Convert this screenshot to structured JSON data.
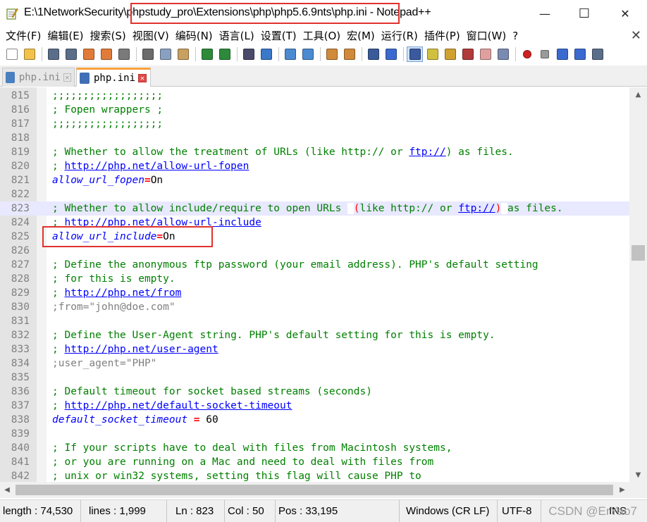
{
  "window": {
    "title": "E:\\1NetworkSecurity\\phpstudy_pro\\Extensions\\php\\php5.6.9nts\\php.ini - Notepad++",
    "controls": {
      "minimize": "—",
      "maximize": "☐",
      "close": "✕"
    }
  },
  "menu": {
    "items": [
      "文件(F)",
      "编辑(E)",
      "搜索(S)",
      "视图(V)",
      "编码(N)",
      "语言(L)",
      "设置(T)",
      "工具(O)",
      "宏(M)",
      "运行(R)",
      "插件(P)",
      "窗口(W)",
      "?"
    ],
    "close": "✕"
  },
  "toolbar": {
    "icons": [
      "new-file-icon",
      "open-file-icon",
      "save-icon",
      "save-all-icon",
      "close-file-icon",
      "close-all-icon",
      "print-icon",
      "cut-icon",
      "copy-icon",
      "paste-icon",
      "undo-icon",
      "redo-icon",
      "find-icon",
      "replace-icon",
      "zoom-in-icon",
      "zoom-out-icon",
      "sync-v-icon",
      "sync-h-icon",
      "word-wrap-icon",
      "show-all-chars-icon",
      "indent-guide-icon",
      "udl-icon",
      "doc-map-icon",
      "function-list-icon",
      "folder-workspace-icon",
      "monitor-icon",
      "record-macro-icon",
      "stop-record-icon",
      "play-macro-icon",
      "run-macro-multiple-icon",
      "save-macro-icon"
    ]
  },
  "tabs": [
    {
      "label": "php.ini",
      "active": false
    },
    {
      "label": "php.ini",
      "active": true
    }
  ],
  "editor": {
    "lines": [
      {
        "n": "815",
        "text": ";;;;;;;;;;;;;;;;;;"
      },
      {
        "n": "816",
        "text": "; Fopen wrappers ;"
      },
      {
        "n": "817",
        "text": ";;;;;;;;;;;;;;;;;;"
      },
      {
        "n": "818",
        "text": ""
      },
      {
        "n": "819",
        "text": "; Whether to allow the treatment of URLs (like http:// or ftp://) as files."
      },
      {
        "n": "820",
        "text": "; http://php.net/allow-url-fopen"
      },
      {
        "n": "821",
        "text": "allow_url_fopen=On"
      },
      {
        "n": "822",
        "text": ""
      },
      {
        "n": "823",
        "text": "; Whether to allow include/require to open URLs (like http:// or ftp://) as files."
      },
      {
        "n": "824",
        "text": "; http://php.net/allow-url-include"
      },
      {
        "n": "825",
        "text": "allow_url_include=On"
      },
      {
        "n": "826",
        "text": ""
      },
      {
        "n": "827",
        "text": "; Define the anonymous ftp password (your email address). PHP's default setting"
      },
      {
        "n": "828",
        "text": "; for this is empty."
      },
      {
        "n": "829",
        "text": "; http://php.net/from"
      },
      {
        "n": "830",
        "text": ";from=\"john@doe.com\""
      },
      {
        "n": "831",
        "text": ""
      },
      {
        "n": "832",
        "text": "; Define the User-Agent string. PHP's default setting for this is empty."
      },
      {
        "n": "833",
        "text": "; http://php.net/user-agent"
      },
      {
        "n": "834",
        "text": ";user_agent=\"PHP\""
      },
      {
        "n": "835",
        "text": ""
      },
      {
        "n": "836",
        "text": "; Default timeout for socket based streams (seconds)"
      },
      {
        "n": "837",
        "text": "; http://php.net/default-socket-timeout"
      },
      {
        "n": "838",
        "text": "default_socket_timeout = 60"
      },
      {
        "n": "839",
        "text": ""
      },
      {
        "n": "840",
        "text": "; If your scripts have to deal with files from Macintosh systems,"
      },
      {
        "n": "841",
        "text": "; or you are running on a Mac and need to deal with files from"
      },
      {
        "n": "842",
        "text": "; unix or win32 systems, setting this flag will cause PHP to"
      }
    ],
    "current_line": "823"
  },
  "status": {
    "length": "length : 74,530",
    "lines": "lines : 1,999",
    "ln": "Ln : 823",
    "col": "Col : 50",
    "pos": "Pos : 33,195",
    "eol": "Windows (CR LF)",
    "encoding": "UTF-8",
    "mode": "INS",
    "watermark": "CSDN @ErYao7"
  },
  "colors": {
    "comment": "#008000",
    "keyword": "#0000ff",
    "operator": "#ff0000",
    "highlight_box": "#e0322d",
    "tab_accent": "#f9a23c"
  }
}
